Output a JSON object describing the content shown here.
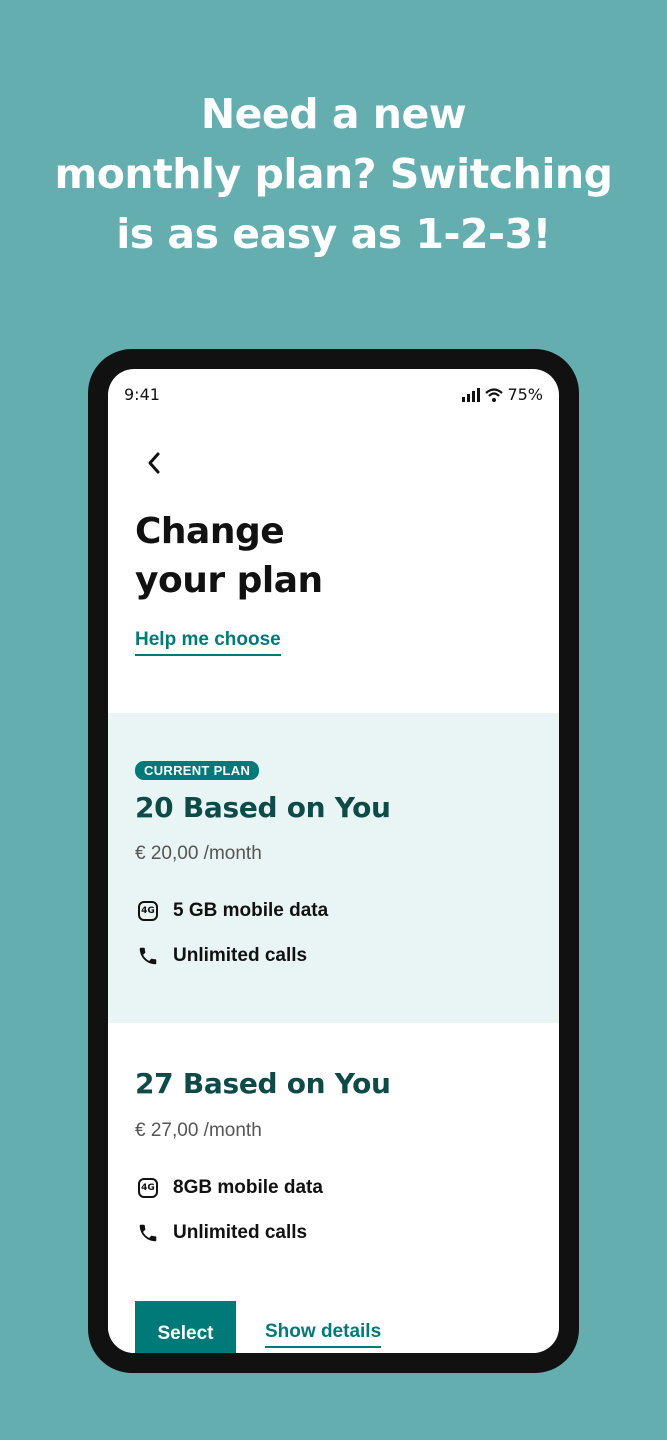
{
  "promo": {
    "headline_lines": [
      "Need a new",
      "monthly plan? Switching",
      "is as easy as 1-2-3!"
    ]
  },
  "status_bar": {
    "time": "9:41",
    "battery": "75%"
  },
  "page": {
    "title_lines": [
      "Change",
      "your plan"
    ],
    "help_link": "Help me choose"
  },
  "plans": [
    {
      "badge": "CURRENT PLAN",
      "name": "20 Based on You",
      "price": "€ 20,00 /month",
      "features": [
        {
          "icon": "4g-icon",
          "label": "5 GB mobile data"
        },
        {
          "icon": "phone-icon",
          "label": "Unlimited calls"
        }
      ]
    },
    {
      "name": "27 Based on You",
      "price": "€ 27,00 /month",
      "features": [
        {
          "icon": "4g-icon",
          "label": "8GB mobile data"
        },
        {
          "icon": "phone-icon",
          "label": "Unlimited calls"
        }
      ],
      "select_label": "Select",
      "details_label": "Show details"
    }
  ],
  "colors": {
    "background": "#64aeb0",
    "accent": "#007a78",
    "current_plan_bg": "#e8f5f4",
    "plan_name": "#0d4a48"
  }
}
